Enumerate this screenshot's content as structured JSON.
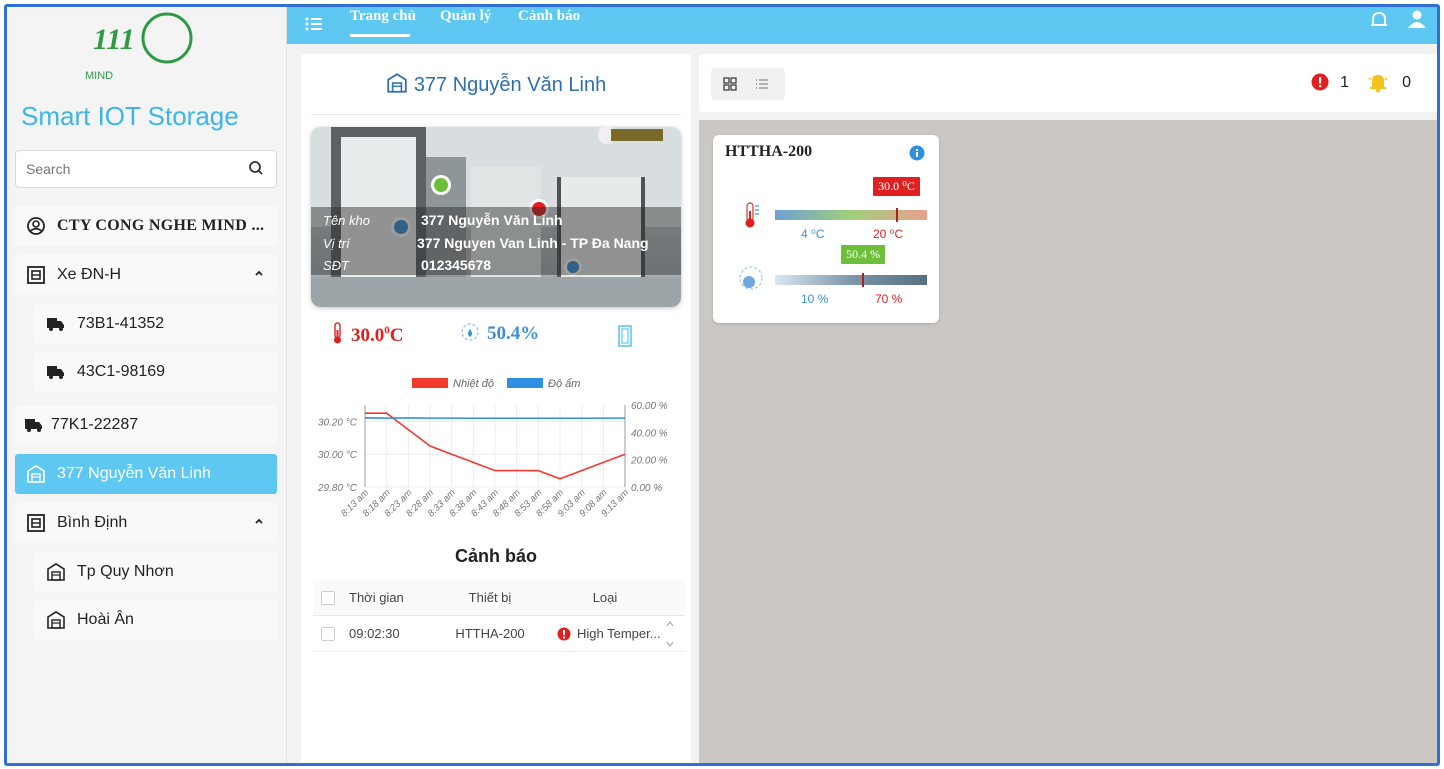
{
  "colors": {
    "accent": "#5ec8f2",
    "brand": "#3db5e6",
    "title_blue": "#2f6fae",
    "danger": "#e02020",
    "humidity_blue": "#3d8fd6",
    "humidity_green": "#6cbf3a"
  },
  "logo": {
    "text": "111",
    "sub": "MIND"
  },
  "sidebar": {
    "brand": "Smart IOT Storage",
    "search_placeholder": "Search",
    "company": "CTY CONG NGHE MIND ...",
    "group1": {
      "label": "Xe ĐN-H",
      "icon": "storage-group-icon"
    },
    "trucks": [
      {
        "label": "73B1-41352",
        "icon": "truck-icon"
      },
      {
        "label": "43C1-98169",
        "icon": "truck-icon"
      }
    ],
    "standalone_truck": {
      "label": "77K1-22287",
      "icon": "truck-icon"
    },
    "active_warehouse": {
      "label": "377 Nguyễn Văn Linh",
      "icon": "warehouse-icon"
    },
    "group2": {
      "label": "Bình Định",
      "icon": "storage-group-icon"
    },
    "warehouses": [
      {
        "label": "Tp Quy Nhơn",
        "icon": "warehouse-icon"
      },
      {
        "label": "Hoài Ân",
        "icon": "warehouse-icon"
      }
    ]
  },
  "topbar": {
    "tabs": [
      "Trang chủ",
      "Quản lý",
      "Cảnh báo"
    ],
    "active_tab": "Trang chủ"
  },
  "warehouse": {
    "title": "377 Nguyễn Văn Linh",
    "labels": {
      "name": "Tên kho",
      "location": "Vị trí",
      "phone": "SĐT"
    },
    "name": "377 Nguyễn Văn Linh",
    "location": "377 Nguyen Van Linh - TP Đa Nang",
    "phone": "012345678",
    "temperature": "30.0",
    "temperature_unit": "0C",
    "humidity": "50.4%"
  },
  "chart_data": {
    "type": "line",
    "x": [
      "8:13 am",
      "8:18 am",
      "8:23 am",
      "8:28 am",
      "8:33 am",
      "8:38 am",
      "8:43 am",
      "8:48 am",
      "8:53 am",
      "8:58 am",
      "9:03 am",
      "9:08 am",
      "9:13 am"
    ],
    "series": [
      {
        "name": "Nhiệt độ",
        "axis": "left",
        "color": "#f23a2f",
        "values": [
          30.25,
          30.25,
          30.15,
          30.05,
          30.0,
          29.95,
          29.9,
          29.9,
          29.9,
          29.85,
          29.9,
          29.95,
          30.0
        ]
      },
      {
        "name": "Độ ẩm",
        "axis": "right",
        "color": "#2f8fe0",
        "values": [
          50.6,
          50.4,
          50.5,
          50.4,
          50.4,
          50.3,
          50.3,
          50.3,
          50.3,
          50.3,
          50.3,
          50.4,
          50.4
        ]
      }
    ],
    "left_ticks": [
      "30.20 °C",
      "30.00 °C",
      "29.80 °C"
    ],
    "right_ticks": [
      "60.00 %",
      "40.00 %",
      "20.00 %",
      "0.00 %"
    ],
    "left_range": [
      29.8,
      30.3
    ],
    "right_range": [
      0,
      60
    ]
  },
  "alerts": {
    "title": "Cảnh báo",
    "columns": [
      "Thời gian",
      "Thiết bị",
      "Loại"
    ],
    "rows": [
      {
        "time": "09:02:30",
        "device": "HTTHA-200",
        "type": "High Temper..."
      }
    ]
  },
  "status": {
    "error_count": "1",
    "bell_count": "0"
  },
  "device_card": {
    "name": "HTTHA-200",
    "temp_value": "30.0 ⁰C",
    "temp_min": "4 ⁰C",
    "temp_max": "20 ⁰C",
    "hum_value": "50.4 %",
    "hum_min": "10 %",
    "hum_max": "70 %",
    "temp_level": 0.8,
    "hum_level": 0.58
  }
}
